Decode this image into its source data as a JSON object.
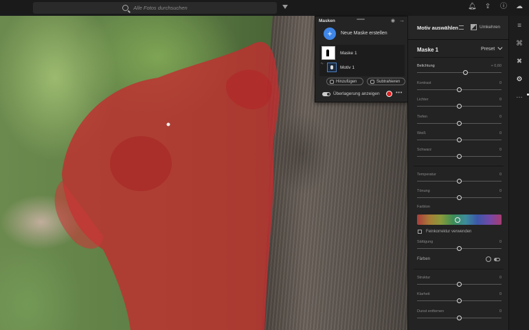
{
  "topbar": {
    "search_placeholder": "Alle Fotos durchsuchen",
    "icons": [
      "search-icon",
      "filter-icon",
      "bell-icon",
      "share-icon",
      "help-icon",
      "cloud-sync-icon"
    ]
  },
  "mask_panel": {
    "title": "Masken",
    "new_mask_label": "Neue Maske erstellen",
    "masks": [
      {
        "name": "Maske 1",
        "thumb_caption": "Ty..."
      },
      {
        "name": "Motiv 1"
      }
    ],
    "add_label": "Hinzufügen",
    "subtract_label": "Subtrahieren",
    "overlay_label": "Überlagerung anzeigen",
    "overlay_color": "#d22222"
  },
  "right_panel": {
    "header_title": "Motiv auswählen",
    "invert_label": "Umkehren",
    "mask_title": "Maske 1",
    "preset_label": "Preset",
    "sliders": [
      {
        "label": "Belichtung",
        "value": "+ 0,60",
        "level": 0.57
      },
      {
        "label": "Kontrast",
        "value": "0",
        "level": 0.5
      },
      {
        "label": "Lichter",
        "value": "0",
        "level": 0.5
      },
      {
        "label": "Tiefen",
        "value": "0",
        "level": 0.5
      },
      {
        "label": "Weiß",
        "value": "0",
        "level": 0.5
      },
      {
        "label": "Schwarz",
        "value": "0",
        "level": 0.5
      },
      {
        "label": "Temperatur",
        "value": "0",
        "level": 0.5
      },
      {
        "label": "Tönung",
        "value": "0",
        "level": 0.5
      },
      {
        "label": "Sättigung",
        "value": "0",
        "level": 0.5
      },
      {
        "label": "Struktur",
        "value": "0",
        "level": 0.5
      },
      {
        "label": "Klarheit",
        "value": "0",
        "level": 0.5
      },
      {
        "label": "Dunst entfernen",
        "value": "0",
        "level": 0.5
      }
    ],
    "hue_label": "Farbton",
    "fine_tune_label": "Feinkorrektur verwenden",
    "color_label": "Färben"
  },
  "tools": [
    "edit-sliders-icon",
    "crop-icon",
    "healing-icon",
    "masking-icon",
    "more-icon"
  ]
}
